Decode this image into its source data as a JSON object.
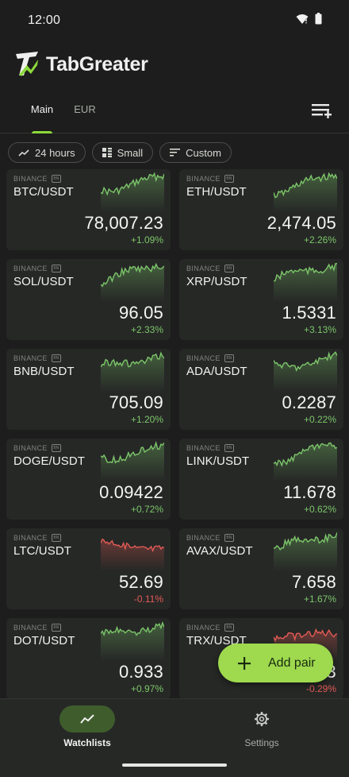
{
  "status_bar": {
    "time": "12:00"
  },
  "app": {
    "brand": "TabGreater"
  },
  "tabs": [
    {
      "label": "Main",
      "active": true
    },
    {
      "label": "EUR",
      "active": false
    }
  ],
  "filters": [
    {
      "label": "24 hours",
      "icon": "trend-icon"
    },
    {
      "label": "Small",
      "icon": "grid-icon"
    },
    {
      "label": "Custom",
      "icon": "sort-icon"
    }
  ],
  "colors": {
    "accent": "#8cd83a",
    "up": "#7cc66a",
    "down": "#e35a55",
    "fab": "#9ed94e"
  },
  "pairs": [
    {
      "exchange": "BINANCE",
      "badge": "BN",
      "pair": "BTC/USDT",
      "price": "78,007.23",
      "change": "+1.09%",
      "trend": "up"
    },
    {
      "exchange": "BINANCE",
      "badge": "BN",
      "pair": "ETH/USDT",
      "price": "2,474.05",
      "change": "+2.26%",
      "trend": "up"
    },
    {
      "exchange": "BINANCE",
      "badge": "BN",
      "pair": "SOL/USDT",
      "price": "96.05",
      "change": "+2.33%",
      "trend": "up"
    },
    {
      "exchange": "BINANCE",
      "badge": "BN",
      "pair": "XRP/USDT",
      "price": "1.5331",
      "change": "+3.13%",
      "trend": "up"
    },
    {
      "exchange": "BINANCE",
      "badge": "BN",
      "pair": "BNB/USDT",
      "price": "705.09",
      "change": "+1.20%",
      "trend": "up"
    },
    {
      "exchange": "BINANCE",
      "badge": "BN",
      "pair": "ADA/USDT",
      "price": "0.2287",
      "change": "+0.22%",
      "trend": "up"
    },
    {
      "exchange": "BINANCE",
      "badge": "BN",
      "pair": "DOGE/USDT",
      "price": "0.09422",
      "change": "+0.72%",
      "trend": "up"
    },
    {
      "exchange": "BINANCE",
      "badge": "BN",
      "pair": "LINK/USDT",
      "price": "11.678",
      "change": "+0.62%",
      "trend": "up"
    },
    {
      "exchange": "BINANCE",
      "badge": "BN",
      "pair": "LTC/USDT",
      "price": "52.69",
      "change": "-0.11%",
      "trend": "down"
    },
    {
      "exchange": "BINANCE",
      "badge": "BN",
      "pair": "AVAX/USDT",
      "price": "7.658",
      "change": "+1.67%",
      "trend": "up"
    },
    {
      "exchange": "BINANCE",
      "badge": "BN",
      "pair": "DOT/USDT",
      "price": "0.933",
      "change": "+0.97%",
      "trend": "up"
    },
    {
      "exchange": "BINANCE",
      "badge": "BN",
      "pair": "TRX/USDT",
      "price": "0.2803",
      "change": "-0.29%",
      "trend": "down"
    }
  ],
  "fab": {
    "label": "Add pair",
    "icon": "plus-icon"
  },
  "bottom_nav": [
    {
      "label": "Watchlists",
      "icon": "trend-icon",
      "active": true
    },
    {
      "label": "Settings",
      "icon": "gear-icon",
      "active": false
    }
  ]
}
